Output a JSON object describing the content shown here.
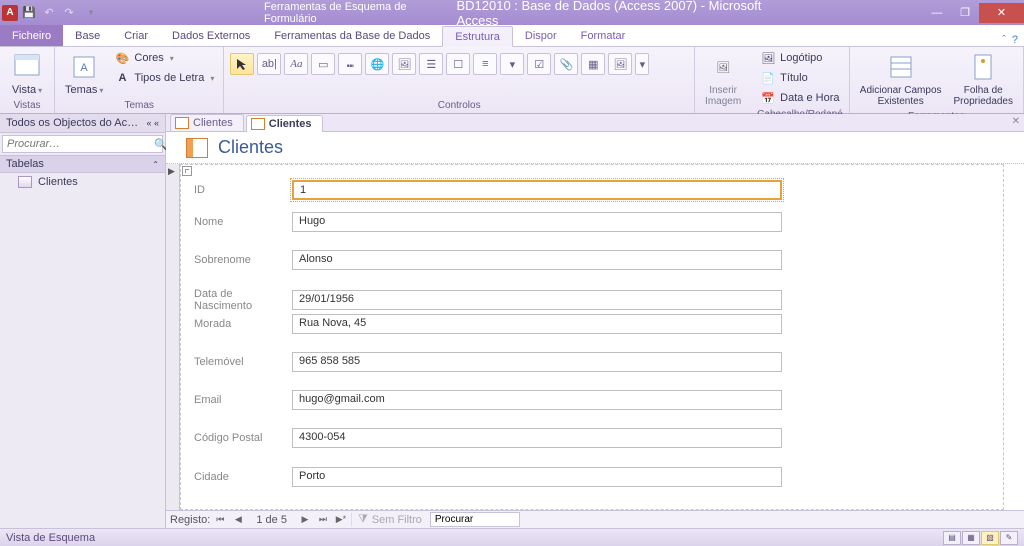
{
  "titlebar": {
    "app_icon_letter": "A",
    "contextual_title": "Ferramentas de Esquema de Formulário",
    "doc_title": "BD12010 : Base de Dados (Access 2007) - Microsoft Access"
  },
  "tabs": {
    "file": "Ficheiro",
    "items": [
      "Base",
      "Criar",
      "Dados Externos",
      "Ferramentas da Base de Dados"
    ],
    "context_items": [
      "Estrutura",
      "Dispor",
      "Formatar"
    ],
    "active": "Estrutura"
  },
  "ribbon": {
    "vistas": {
      "label": "Vistas",
      "vista": "Vista"
    },
    "temas": {
      "label": "Temas",
      "temas": "Temas",
      "cores": "Cores",
      "tipos": "Tipos de Letra"
    },
    "controlos": {
      "label": "Controlos",
      "aa": "Aa"
    },
    "inserir_img": {
      "label": "Inserir\nImagem"
    },
    "cabecalho": {
      "label": "Cabeçalho/Rodapé",
      "logotipo": "Logótipo",
      "titulo": "Título",
      "data": "Data e Hora"
    },
    "ferramentas": {
      "label": "Ferramentas",
      "adicionar": "Adicionar Campos\nExistentes",
      "folha": "Folha de\nPropriedades"
    }
  },
  "nav": {
    "header": "Todos os Objectos do Ac…",
    "search_placeholder": "Procurar…",
    "section": "Tabelas",
    "item1": "Clientes"
  },
  "doc_tabs": {
    "tab1": "Clientes",
    "tab2": "Clientes"
  },
  "form": {
    "title": "Clientes",
    "fields": {
      "id": {
        "label": "ID",
        "value": "1"
      },
      "nome": {
        "label": "Nome",
        "value": "Hugo"
      },
      "sobrenome": {
        "label": "Sobrenome",
        "value": "Alonso"
      },
      "nascimento": {
        "label": "Data de Nascimento",
        "value": "29/01/1956"
      },
      "morada": {
        "label": "Morada",
        "value": "Rua Nova, 45"
      },
      "telemovel": {
        "label": "Telemóvel",
        "value": "965 858 585"
      },
      "email": {
        "label": "Email",
        "value": "hugo@gmail.com"
      },
      "codpostal": {
        "label": "Código Postal",
        "value": "4300-054"
      },
      "cidade": {
        "label": "Cidade",
        "value": "Porto"
      }
    }
  },
  "recnav": {
    "label": "Registo:",
    "counter": "1 de 5",
    "filter": "Sem Filtro",
    "search": "Procurar"
  },
  "status": {
    "text": "Vista de Esquema"
  }
}
